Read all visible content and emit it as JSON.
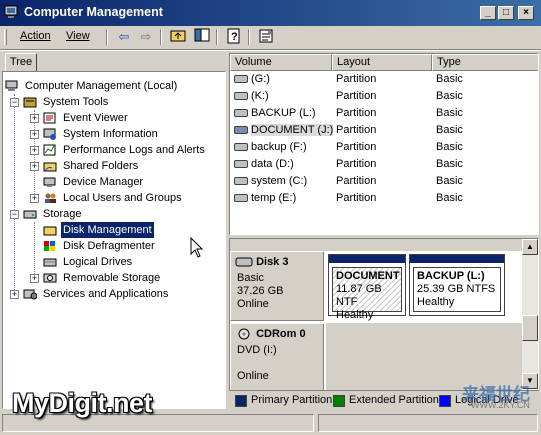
{
  "window": {
    "title": "Computer Management"
  },
  "menu": {
    "action": "Action",
    "view": "View"
  },
  "toolbar_icons": [
    "back-arrow-icon",
    "forward-arrow-icon",
    "up-folder-icon",
    "show-hide-tree-icon",
    "help-icon",
    "properties-icon"
  ],
  "tree": {
    "tab": "Tree",
    "root": "Computer Management (Local)",
    "system_tools": "System Tools",
    "event_viewer": "Event Viewer",
    "system_information": "System Information",
    "perf_logs": "Performance Logs and Alerts",
    "shared_folders": "Shared Folders",
    "device_manager": "Device Manager",
    "local_users": "Local Users and Groups",
    "storage": "Storage",
    "disk_management": "Disk Management",
    "disk_defragmenter": "Disk Defragmenter",
    "logical_drives": "Logical Drives",
    "removable_storage": "Removable Storage",
    "services_apps": "Services and Applications"
  },
  "list": {
    "columns": [
      "Volume",
      "Layout",
      "Type"
    ],
    "rows": [
      {
        "volume": "(G:)",
        "layout": "Partition",
        "type": "Basic"
      },
      {
        "volume": "(K:)",
        "layout": "Partition",
        "type": "Basic"
      },
      {
        "volume": "BACKUP (L:)",
        "layout": "Partition",
        "type": "Basic"
      },
      {
        "volume": "DOCUMENT (J:)",
        "layout": "Partition",
        "type": "Basic"
      },
      {
        "volume": "backup (F:)",
        "layout": "Partition",
        "type": "Basic"
      },
      {
        "volume": "data (D:)",
        "layout": "Partition",
        "type": "Basic"
      },
      {
        "volume": "system (C:)",
        "layout": "Partition",
        "type": "Basic"
      },
      {
        "volume": "temp (E:)",
        "layout": "Partition",
        "type": "Basic"
      }
    ]
  },
  "disks": {
    "disk3": {
      "name": "Disk 3",
      "type": "Basic",
      "size": "37.26 GB",
      "status": "Online"
    },
    "cdrom0": {
      "name": "CDRom 0",
      "type": "DVD (I:)",
      "status": "Online"
    },
    "partitions": [
      {
        "name": "DOCUMENT",
        "info": "11.87 GB NTF",
        "status": "Healthy"
      },
      {
        "name": "BACKUP  (L:)",
        "info": "25.39 GB NTFS",
        "status": "Healthy"
      }
    ]
  },
  "legend": [
    {
      "label": "Primary Partition",
      "color": "#0a246a"
    },
    {
      "label": "Extended Partition",
      "color": "#008000"
    },
    {
      "label": "Logical Drive",
      "color": "#0000ff"
    }
  ],
  "watermarks": {
    "main": "MyDigit.net",
    "cn": "来福世纪",
    "url": "WWW.2KY.CN"
  }
}
